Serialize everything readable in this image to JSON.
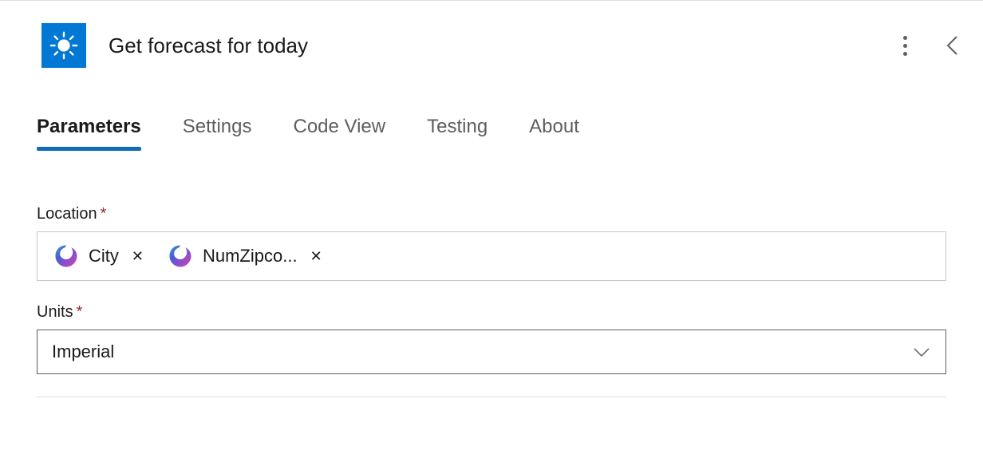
{
  "header": {
    "title": "Get forecast for today"
  },
  "tabs": {
    "items": [
      {
        "label": "Parameters",
        "active": true
      },
      {
        "label": "Settings",
        "active": false
      },
      {
        "label": "Code View",
        "active": false
      },
      {
        "label": "Testing",
        "active": false
      },
      {
        "label": "About",
        "active": false
      }
    ]
  },
  "form": {
    "location": {
      "label": "Location",
      "tokens": [
        {
          "label": "City"
        },
        {
          "label": "NumZipco..."
        }
      ]
    },
    "units": {
      "label": "Units",
      "value": "Imperial"
    }
  }
}
